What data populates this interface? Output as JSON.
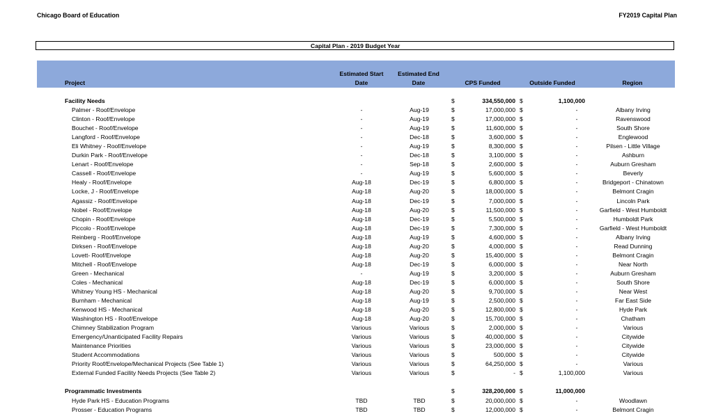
{
  "header": {
    "organization": "Chicago Board of Education",
    "document_title": "FY2019 Capital Plan",
    "table_title": "Capital Plan - 2019 Budget Year"
  },
  "columns": {
    "project": "Project",
    "start": "Estimated Start Date",
    "end": "Estimated End Date",
    "cps": "CPS Funded",
    "outside": "Outside Funded",
    "region": "Region"
  },
  "colors": {
    "header_bg": "#8da9db"
  },
  "sections": [
    {
      "name": "Facility Needs",
      "cps_total": "334,550,000",
      "outside_total": "1,100,000",
      "rows": [
        {
          "project": "Palmer - Roof/Envelope",
          "start": "-",
          "end": "Aug-19",
          "cps": "17,000,000",
          "outside": "-",
          "region": "Albany Irving"
        },
        {
          "project": "Clinton - Roof/Envelope",
          "start": "-",
          "end": "Aug-19",
          "cps": "17,000,000",
          "outside": "-",
          "region": "Ravenswood"
        },
        {
          "project": "Bouchet - Roof/Envelope",
          "start": "-",
          "end": "Aug-19",
          "cps": "11,600,000",
          "outside": "-",
          "region": "South Shore"
        },
        {
          "project": "Langford - Roof/Envelope",
          "start": "-",
          "end": "Dec-18",
          "cps": "3,600,000",
          "outside": "-",
          "region": "Englewood"
        },
        {
          "project": "Eli Whitney - Roof/Envelope",
          "start": "-",
          "end": "Aug-19",
          "cps": "8,300,000",
          "outside": "-",
          "region": "Pilsen - Little Village"
        },
        {
          "project": "Durkin Park - Roof/Envelope",
          "start": "-",
          "end": "Dec-18",
          "cps": "3,100,000",
          "outside": "-",
          "region": "Ashburn"
        },
        {
          "project": "Lenart - Roof/Envelope",
          "start": "-",
          "end": "Sep-18",
          "cps": "2,600,000",
          "outside": "-",
          "region": "Auburn Gresham"
        },
        {
          "project": "Cassell - Roof/Envelope",
          "start": "-",
          "end": "Aug-19",
          "cps": "5,600,000",
          "outside": "-",
          "region": "Beverly"
        },
        {
          "project": "Healy - Roof/Envelope",
          "start": "Aug-18",
          "end": "Dec-19",
          "cps": "6,800,000",
          "outside": "-",
          "region": "Bridgeport - Chinatown"
        },
        {
          "project": "Locke, J - Roof/Envelope",
          "start": "Aug-18",
          "end": "Aug-20",
          "cps": "18,000,000",
          "outside": "-",
          "region": "Belmont Cragin"
        },
        {
          "project": "Agassiz - Roof/Envelope",
          "start": "Aug-18",
          "end": "Dec-19",
          "cps": "7,000,000",
          "outside": "-",
          "region": "Lincoln Park"
        },
        {
          "project": "Nobel - Roof/Envelope",
          "start": "Aug-18",
          "end": "Aug-20",
          "cps": "11,500,000",
          "outside": "-",
          "region": "Garfield - West Humboldt"
        },
        {
          "project": "Chopin - Roof/Envelope",
          "start": "Aug-18",
          "end": "Dec-19",
          "cps": "5,500,000",
          "outside": "-",
          "region": "Humboldt Park"
        },
        {
          "project": "Piccolo - Roof/Envelope",
          "start": "Aug-18",
          "end": "Dec-19",
          "cps": "7,300,000",
          "outside": "-",
          "region": "Garfield - West Humboldt"
        },
        {
          "project": "Reinberg - Roof/Envelope",
          "start": "Aug-18",
          "end": "Aug-19",
          "cps": "4,600,000",
          "outside": "-",
          "region": "Albany Irving"
        },
        {
          "project": "Dirksen - Roof/Envelope",
          "start": "Aug-18",
          "end": "Aug-20",
          "cps": "4,000,000",
          "outside": "-",
          "region": "Read Dunning"
        },
        {
          "project": "Lovett- Roof/Envelope",
          "start": "Aug-18",
          "end": "Aug-20",
          "cps": "15,400,000",
          "outside": "-",
          "region": "Belmont Cragin"
        },
        {
          "project": "Mitchell - Roof/Envelope",
          "start": "Aug-18",
          "end": "Dec-19",
          "cps": "6,000,000",
          "outside": "-",
          "region": "Near North"
        },
        {
          "project": "Green - Mechanical",
          "start": "-",
          "end": "Aug-19",
          "cps": "3,200,000",
          "outside": "-",
          "region": "Auburn Gresham"
        },
        {
          "project": "Coles - Mechanical",
          "start": "Aug-18",
          "end": "Dec-19",
          "cps": "6,000,000",
          "outside": "-",
          "region": "South Shore"
        },
        {
          "project": "Whitney Young HS - Mechanical",
          "start": "Aug-18",
          "end": "Aug-20",
          "cps": "9,700,000",
          "outside": "-",
          "region": "Near West"
        },
        {
          "project": "Burnham - Mechanical",
          "start": "Aug-18",
          "end": "Aug-19",
          "cps": "2,500,000",
          "outside": "-",
          "region": "Far East Side"
        },
        {
          "project": "Kenwood HS - Mechanical",
          "start": "Aug-18",
          "end": "Aug-20",
          "cps": "12,800,000",
          "outside": "-",
          "region": "Hyde Park"
        },
        {
          "project": "Washington HS - Roof/Envelope",
          "start": "Aug-18",
          "end": "Aug-20",
          "cps": "15,700,000",
          "outside": "-",
          "region": "Chatham"
        },
        {
          "project": "Chimney Stabilization Program",
          "start": "Various",
          "end": "Various",
          "cps": "2,000,000",
          "outside": "-",
          "region": "Various"
        },
        {
          "project": "Emergency/Unanticipated Facility Repairs",
          "start": "Various",
          "end": "Various",
          "cps": "40,000,000",
          "outside": "-",
          "region": "Citywide"
        },
        {
          "project": "Maintenance Priorities",
          "start": "Various",
          "end": "Various",
          "cps": "23,000,000",
          "outside": "-",
          "region": "Citywide"
        },
        {
          "project": "Student Accommodations",
          "start": "Various",
          "end": "Various",
          "cps": "500,000",
          "outside": "-",
          "region": "Citywide"
        },
        {
          "project": "Priority Roof/Envelope/Mechanical Projects (See Table 1)",
          "start": "Various",
          "end": "Various",
          "cps": "64,250,000",
          "outside": "-",
          "region": "Various"
        },
        {
          "project": "External Funded Facility Needs Projects (See Table 2)",
          "start": "Various",
          "end": "Various",
          "cps": "-",
          "outside": "1,100,000",
          "region": "Various"
        }
      ]
    },
    {
      "name": "Programmatic Investments",
      "cps_total": "328,200,000",
      "outside_total": "11,000,000",
      "rows": [
        {
          "project": "Hyde Park HS - Education Programs",
          "start": "TBD",
          "end": "TBD",
          "cps": "20,000,000",
          "outside": "-",
          "region": "Woodlawn"
        },
        {
          "project": "Prosser - Education Programs",
          "start": "TBD",
          "end": "TBD",
          "cps": "12,000,000",
          "outside": "-",
          "region": "Belmont Cragin"
        }
      ]
    }
  ],
  "currency_symbol": "$"
}
